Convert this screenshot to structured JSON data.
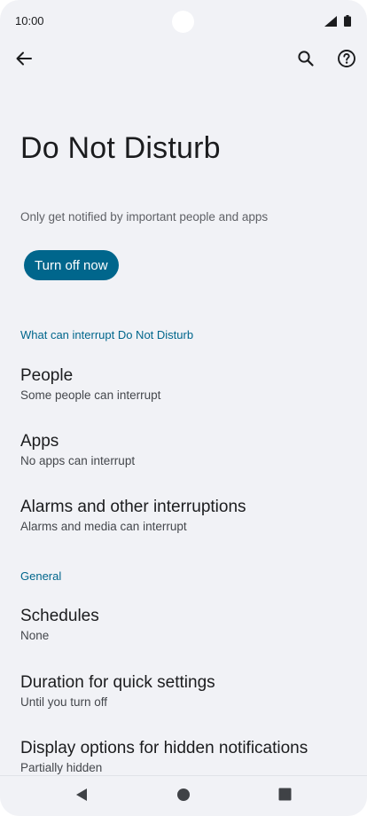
{
  "status_bar": {
    "time": "10:00",
    "icons": [
      "signal-icon",
      "battery-icon"
    ]
  },
  "toolbar": {
    "back_icon": "arrow-back-icon",
    "search_icon": "search-icon",
    "help_icon": "help-icon"
  },
  "header": {
    "title": "Do Not Disturb",
    "subtitle": "Only get notified by important people and apps",
    "action_label": "Turn off now"
  },
  "sections": [
    {
      "header": "What can interrupt Do Not Disturb",
      "items": [
        {
          "title": "People",
          "summary": "Some people can interrupt"
        },
        {
          "title": "Apps",
          "summary": "No apps can interrupt"
        },
        {
          "title": "Alarms and other interruptions",
          "summary": "Alarms and media can interrupt"
        }
      ]
    },
    {
      "header": "General",
      "items": [
        {
          "title": "Schedules",
          "summary": "None"
        },
        {
          "title": "Duration for quick settings",
          "summary": "Until you turn off"
        },
        {
          "title": "Display options for hidden notifications",
          "summary": "Partially hidden"
        }
      ]
    }
  ],
  "nav_bar": {
    "icons": [
      "nav-back-icon",
      "nav-home-icon",
      "nav-recents-icon"
    ]
  },
  "colors": {
    "accent": "#00668c",
    "background": "#f1f2f6",
    "text_primary": "#1b1c1e",
    "text_secondary": "#44474c"
  }
}
